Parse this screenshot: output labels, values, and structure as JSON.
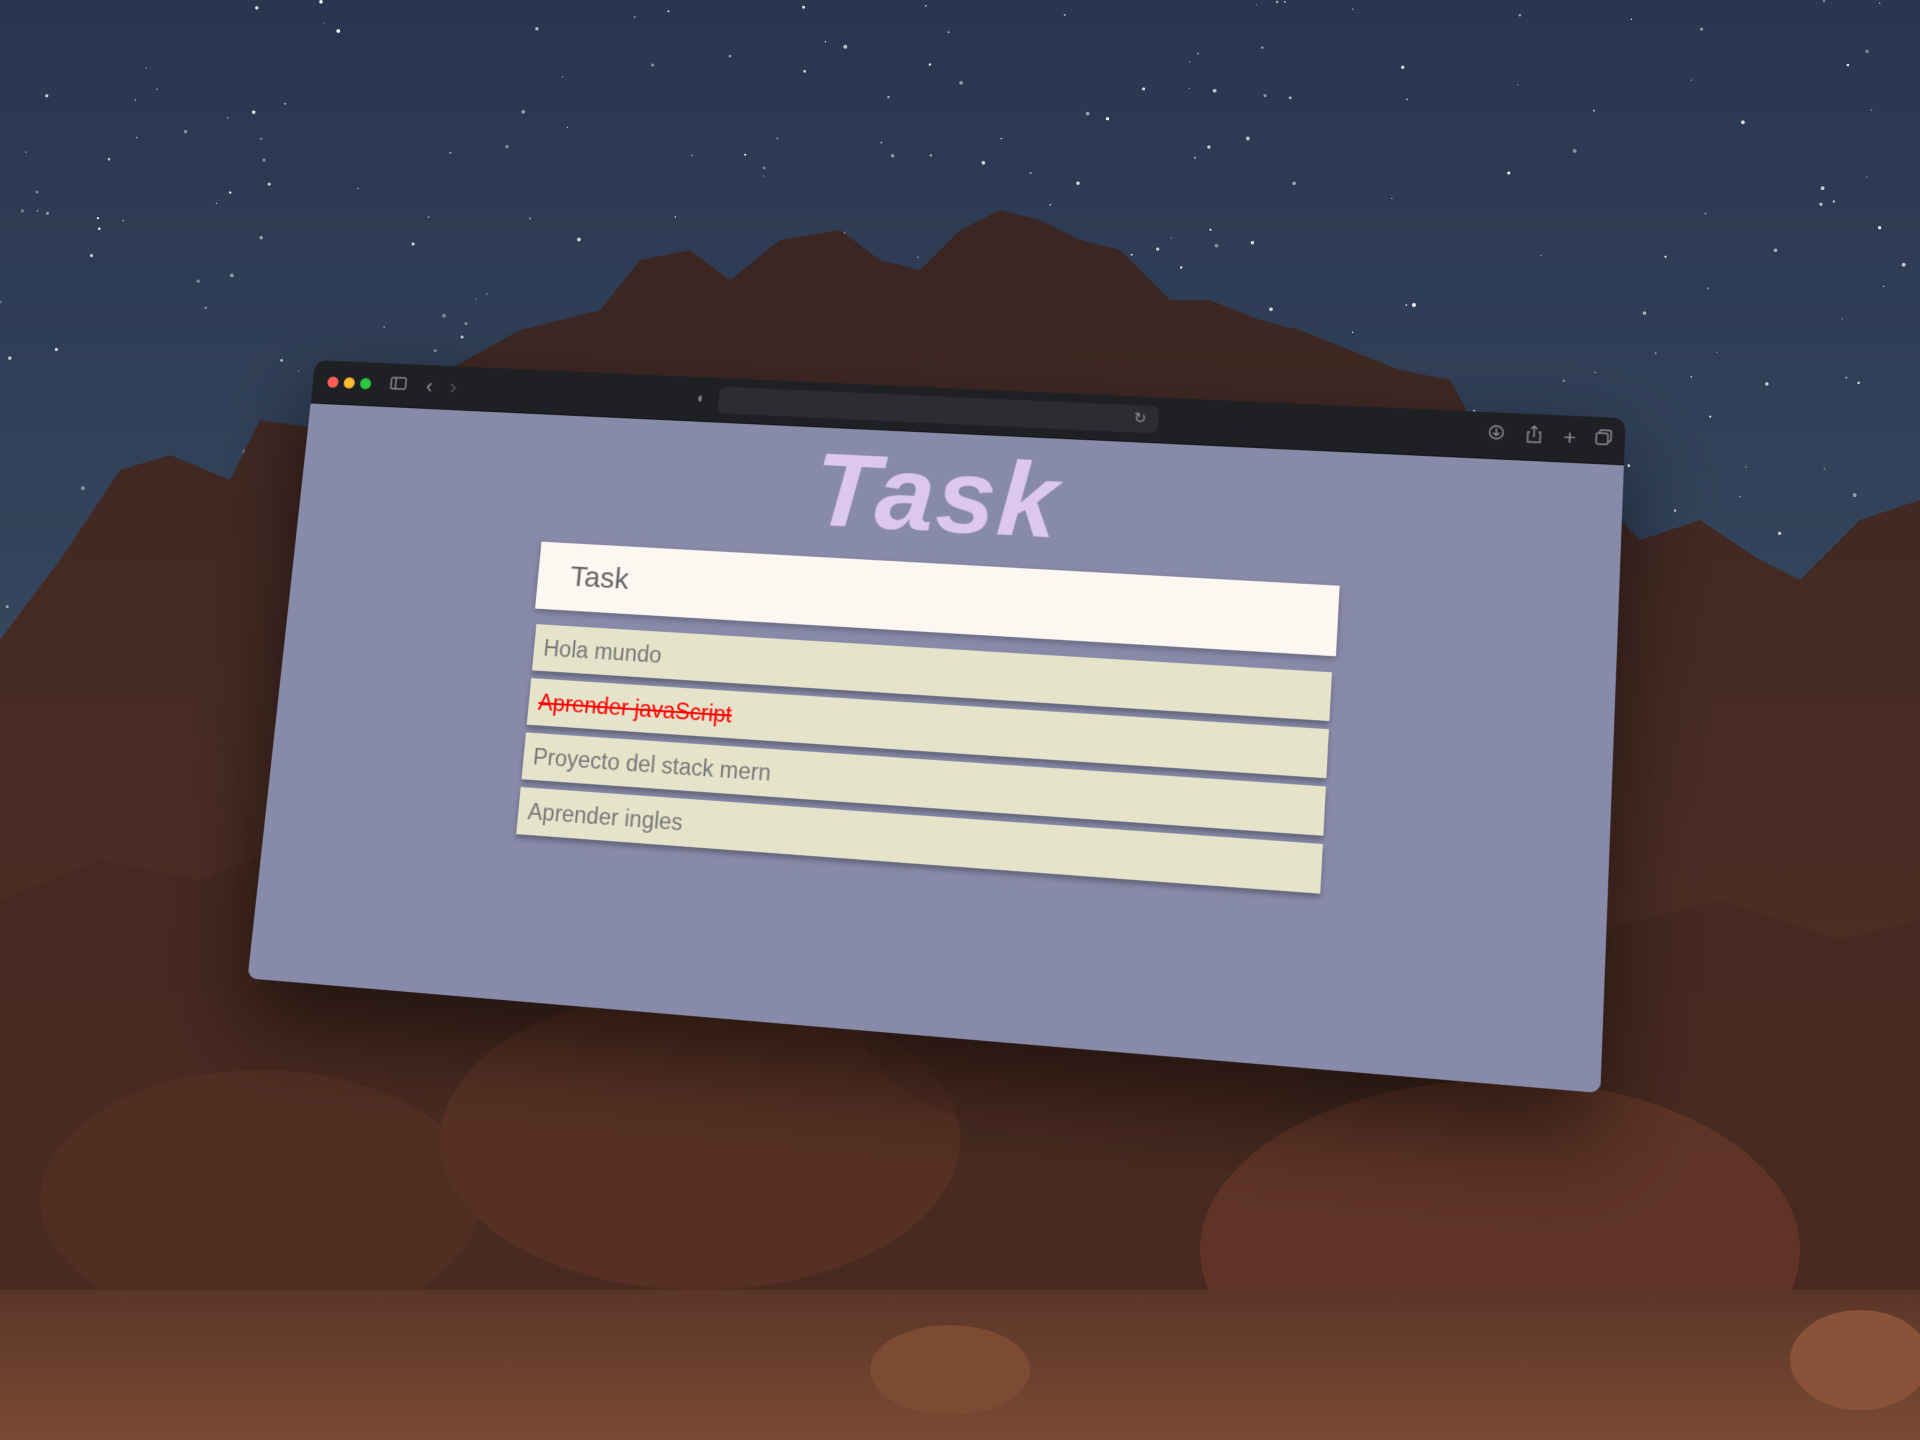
{
  "page": {
    "title": "Task"
  },
  "input": {
    "placeholder": "Task"
  },
  "tasks": [
    {
      "text": "Hola mundo",
      "done": false
    },
    {
      "text": "Aprender javaScript",
      "done": true
    },
    {
      "text": "Proyecto del stack mern",
      "done": false
    },
    {
      "text": "Aprender ingles",
      "done": false
    }
  ],
  "browser": {
    "icons": {
      "sidebar": "sidebar-icon",
      "back": "chevron-left-icon",
      "forward": "chevron-right-icon",
      "privacy": "shield-icon",
      "reload": "reload-icon",
      "download": "download-icon",
      "share": "share-icon",
      "new_tab": "plus-icon",
      "tab_overview": "tabs-icon"
    },
    "traffic_colors": [
      "#ff5f57",
      "#febc2e",
      "#28c840"
    ]
  },
  "colors": {
    "page_background": "#888aa9",
    "title": "#dcc8ef",
    "input_background": "#fdf7f2",
    "item_background": "#e5e4cb",
    "item_text": "#777777",
    "done_text": "#ff0000"
  }
}
